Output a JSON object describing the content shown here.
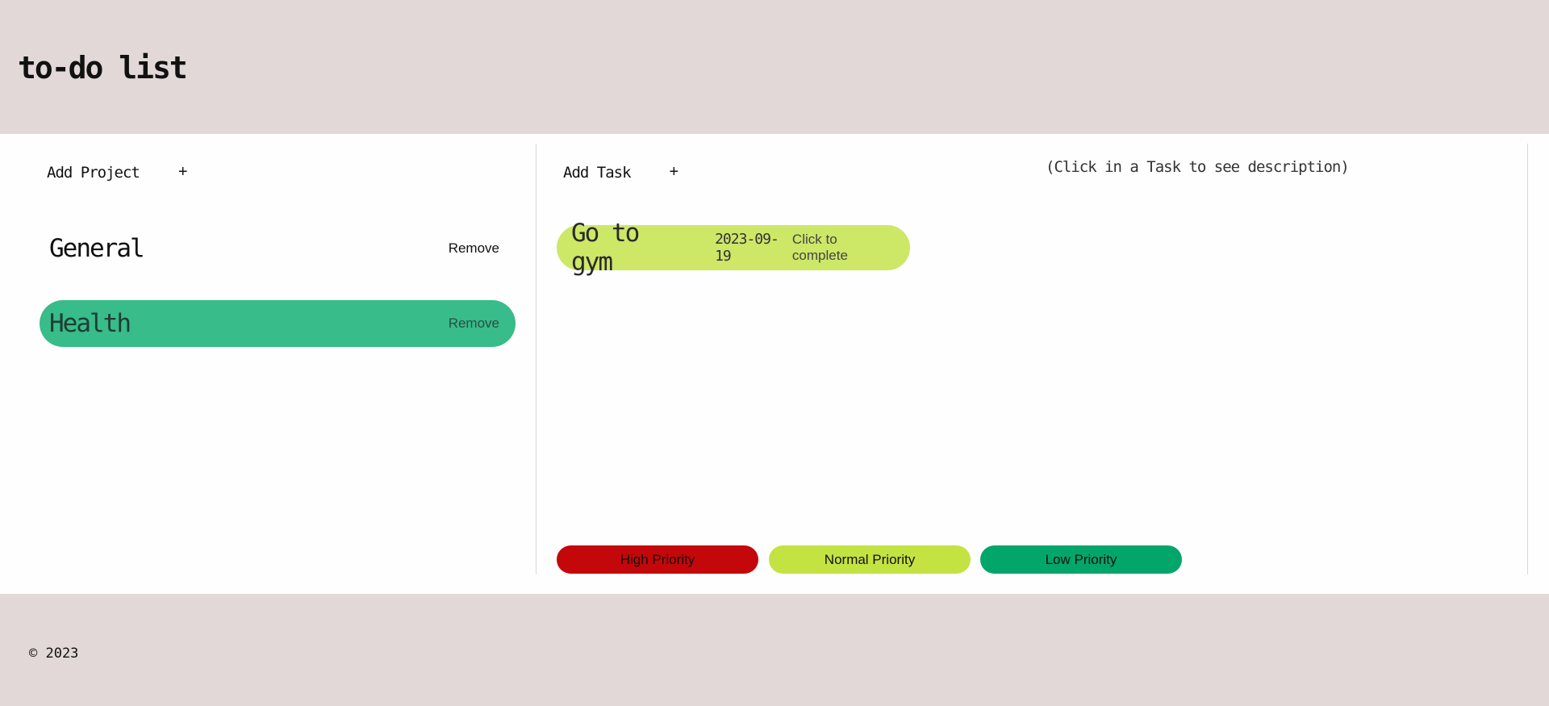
{
  "header": {
    "title": "to-do list"
  },
  "projects_panel": {
    "add_label": "Add Project",
    "add_icon": "+",
    "items": [
      {
        "name": "General",
        "remove_label": "Remove",
        "selected": false
      },
      {
        "name": "Health",
        "remove_label": "Remove",
        "selected": true
      }
    ]
  },
  "tasks_panel": {
    "add_label": "Add Task",
    "add_icon": "+",
    "hint": "(Click in a Task to see description)",
    "items": [
      {
        "name": "Go to gym",
        "date": "2023-09-19",
        "complete_label": "Click to complete"
      }
    ]
  },
  "legend": {
    "high": {
      "label": "High Priority",
      "color": "#c3070a"
    },
    "normal": {
      "label": "Normal Priority",
      "color": "#c2e342"
    },
    "low": {
      "label": "Low Priority",
      "color": "#03a66a"
    }
  },
  "footer": {
    "copyright": "© 2023"
  },
  "colors": {
    "header_bg": "#e2d8d8",
    "selected_project": "#37bc8a",
    "task_bg": "#cde767"
  }
}
